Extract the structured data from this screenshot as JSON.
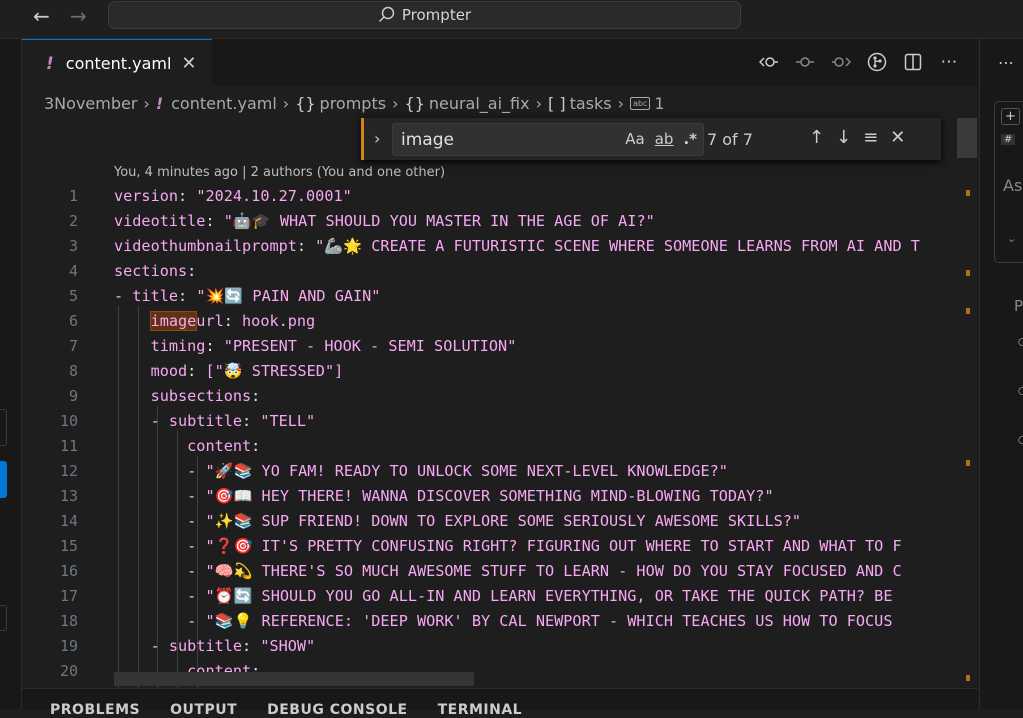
{
  "titlebar": {
    "search_label": "Prompter"
  },
  "tab": {
    "label": "content.yaml",
    "close": "✕",
    "bang": "!"
  },
  "breadcrumb": {
    "items": [
      "3November",
      "content.yaml",
      "prompts",
      "neural_ai_fix",
      "tasks",
      "1"
    ],
    "sym_obj": "{}",
    "sym_arr": "[ ]",
    "abc": "abc"
  },
  "find": {
    "query": "image",
    "match_case": "Aa",
    "whole_word": "ab",
    "regex": ".*",
    "count": "7 of 7"
  },
  "blame": "You, 4 minutes ago | 2 authors (You and one other)",
  "bottom_tabs": [
    "PROBLEMS",
    "OUTPUT",
    "DEBUG CONSOLE",
    "TERMINAL"
  ],
  "right_panel": {
    "label": "As",
    "letter": "P"
  },
  "lines": [
    {
      "n": "1",
      "key": "version",
      "val": "\"2024.10.27.0001\""
    },
    {
      "n": "2",
      "key": "videotitle",
      "val": "\"🤖🎓 WHAT SHOULD YOU MASTER IN THE AGE OF AI?\""
    },
    {
      "n": "3",
      "key": "videothumbnailprompt",
      "val": "\"🦾🌟 CREATE A FUTURISTIC SCENE WHERE SOMEONE LEARNS FROM AI AND T"
    },
    {
      "n": "4",
      "key": "sections",
      "val": ""
    },
    {
      "n": "5",
      "key": "title",
      "val": "\"💥🔄 PAIN AND GAIN\""
    },
    {
      "n": "6",
      "key": "url",
      "val": "hook.png",
      "hl": "image"
    },
    {
      "n": "7",
      "key": "timing",
      "val": "\"PRESENT - HOOK - SEMI SOLUTION\""
    },
    {
      "n": "8",
      "key": "mood",
      "val": "[\"🤯 STRESSED\"]"
    },
    {
      "n": "9",
      "key": "subsections",
      "val": ""
    },
    {
      "n": "10",
      "key": "subtitle",
      "val": "\"TELL\""
    },
    {
      "n": "11",
      "key": "content",
      "val": ""
    },
    {
      "n": "12",
      "key": "",
      "val": "\"🚀📚 YO FAM! READY TO UNLOCK SOME NEXT-LEVEL KNOWLEDGE?\""
    },
    {
      "n": "13",
      "key": "",
      "val": "\"🎯📖 HEY THERE! WANNA DISCOVER SOMETHING MIND-BLOWING TODAY?\""
    },
    {
      "n": "14",
      "key": "",
      "val": "\"✨📚 SUP FRIEND! DOWN TO EXPLORE SOME SERIOUSLY AWESOME SKILLS?\""
    },
    {
      "n": "15",
      "key": "",
      "val": "\"❓🎯 IT'S PRETTY CONFUSING RIGHT? FIGURING OUT WHERE TO START AND WHAT TO F"
    },
    {
      "n": "16",
      "key": "",
      "val": "\"🧠💫 THERE'S SO MUCH AWESOME STUFF TO LEARN - HOW DO YOU STAY FOCUSED AND C"
    },
    {
      "n": "17",
      "key": "",
      "val": "\"⏰🔄 SHOULD YOU GO ALL-IN AND LEARN EVERYTHING, OR TAKE THE QUICK PATH? BE"
    },
    {
      "n": "18",
      "key": "",
      "val": "\"📚💡 REFERENCE: 'DEEP WORK' BY CAL NEWPORT - WHICH TEACHES US HOW TO FOCUS"
    },
    {
      "n": "19",
      "key": "subtitle",
      "val": "\"SHOW\""
    },
    {
      "n": "20",
      "key": "content",
      "val": ""
    }
  ],
  "colors": {
    "accent": "#0078d4",
    "find_border": "#d18616",
    "yaml_key": "#f7a8f2"
  }
}
